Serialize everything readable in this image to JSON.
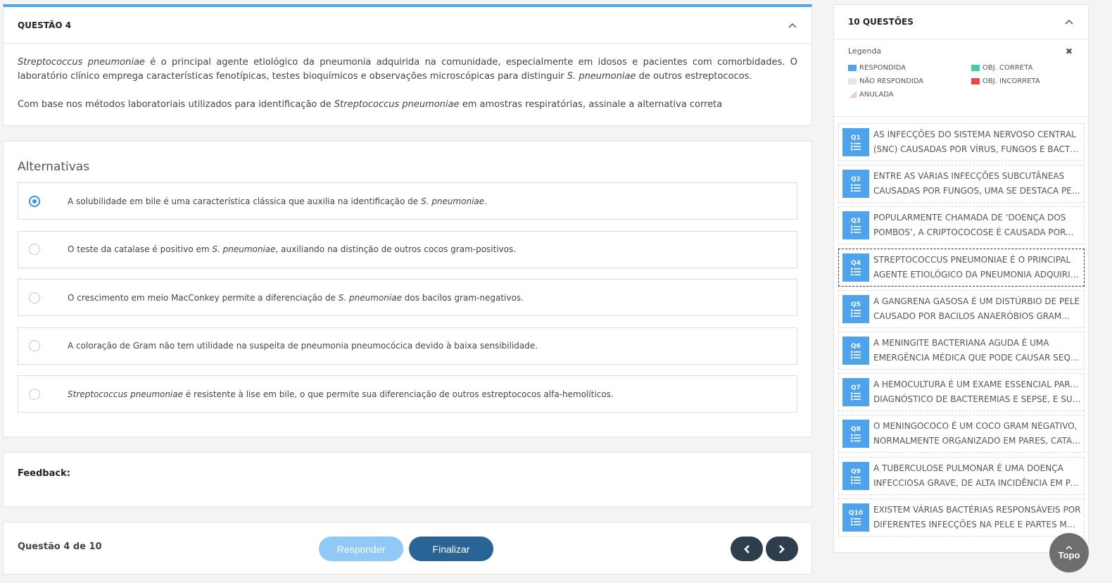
{
  "question": {
    "title": "QUESTÃO 4",
    "para1": [
      {
        "t": "Streptococcus pneumoniae",
        "i": true
      },
      {
        "t": " é o principal agente etiológico da pneumonia adquirida na comunidade, especialmente em idosos e pacientes com comorbidades. O laboratório clínico emprega características fenotípicas, testes bioquímicos e observações microscópicas para distinguir ",
        "i": false
      },
      {
        "t": "S. pneumoniae",
        "i": true
      },
      {
        "t": " de outros estreptococos.",
        "i": false
      }
    ],
    "para2": [
      {
        "t": "Com base nos métodos laboratoriais utilizados para identificação de ",
        "i": false
      },
      {
        "t": "Streptococcus pneumoniae",
        "i": true
      },
      {
        "t": " em amostras respiratórias, assinale a alternativa correta",
        "i": false
      }
    ]
  },
  "alternatives": {
    "title": "Alternativas",
    "items": [
      {
        "selected": true,
        "parts": [
          {
            "t": "A solubilidade em bile é uma característica clássica que auxilia na identificação de ",
            "i": false
          },
          {
            "t": "S. pneumoniae",
            "i": true
          },
          {
            "t": ".",
            "i": false
          }
        ]
      },
      {
        "selected": false,
        "parts": [
          {
            "t": "O teste da catalase é positivo em ",
            "i": false
          },
          {
            "t": "S. pneumoniae",
            "i": true
          },
          {
            "t": ", auxiliando na distinção de outros cocos gram-positivos.",
            "i": false
          }
        ]
      },
      {
        "selected": false,
        "parts": [
          {
            "t": "O crescimento em meio MacConkey permite a diferenciação de ",
            "i": false
          },
          {
            "t": "S. pneumoniae",
            "i": true
          },
          {
            "t": " dos bacilos gram-negativos.",
            "i": false
          }
        ]
      },
      {
        "selected": false,
        "parts": [
          {
            "t": "A coloração de Gram não tem utilidade na suspeita de pneumonia pneumocócica devido à baixa sensibilidade.",
            "i": false
          }
        ]
      },
      {
        "selected": false,
        "parts": [
          {
            "t": "Streptococcus pneumoniae",
            "i": true
          },
          {
            "t": " é resistente à lise em bile, o que permite sua diferenciação de outros estreptococos alfa-hemolíticos.",
            "i": false
          }
        ]
      }
    ]
  },
  "feedback": {
    "label": "Feedback:"
  },
  "nav": {
    "counter": "Questão 4 de 10",
    "responder": "Responder",
    "finalizar": "Finalizar"
  },
  "side": {
    "title": "10 QUESTÕES",
    "legend": {
      "title": "Legenda",
      "close": "✖",
      "items": [
        {
          "label": "RESPONDIDA",
          "color": "#4da3ec"
        },
        {
          "label": "OBJ. CORRETA",
          "color": "#3ecfa8"
        },
        {
          "label": "NÃO RESPONDIDA",
          "color": "#e6e6e6"
        },
        {
          "label": "OBJ. INCORRETA",
          "color": "#e8474c"
        },
        {
          "label": "ANULADA",
          "color": "#f7c7c7"
        }
      ]
    },
    "questions": [
      {
        "num": "Q1",
        "l1": "AS INFECÇÕES DO SISTEMA NERVOSO CENTRAL",
        "l2": "(SNC) CAUSADAS POR VÍRUS, FUNGOS E BACTÉRIAS..."
      },
      {
        "num": "Q2",
        "l1": "ENTRE AS VÁRIAS INFECÇÕES SUBCUTÂNEAS",
        "l2": "CAUSADAS POR FUNGOS, UMA SE DESTACA PELA..."
      },
      {
        "num": "Q3",
        "l1": "POPULARMENTE CHAMADA DE ‘DOENÇA DOS",
        "l2": "POMBOS’, A CRIPTOCOCOSE É CAUSADA POR..."
      },
      {
        "num": "Q4",
        "l1": "STREPTOCOCCUS PNEUMONIAE É O PRINCIPAL",
        "l2": "AGENTE ETIOLÓGICO DA PNEUMONIA ADQUIRIDA..."
      },
      {
        "num": "Q5",
        "l1": "A GANGRENA GASOSA É UM DISTÚRBIO DE PELE",
        "l2": "CAUSADO POR BACILOS ANAERÓBIOS GRAM..."
      },
      {
        "num": "Q6",
        "l1": "A MENINGITE BACTERIANA AGUDA É UMA",
        "l2": "EMERGÊNCIA MÉDICA QUE PODE CAUSAR SEQUELAS..."
      },
      {
        "num": "Q7",
        "l1": "A HEMOCULTURA É UM EXAME ESSENCIAL PARA O",
        "l2": "DIAGNÓSTICO DE BACTEREMIAS E SEPSE, E SUA..."
      },
      {
        "num": "Q8",
        "l1": "O MENINGOCOCO É UM COCO GRAM NEGATIVO,",
        "l2": "NORMALMENTE ORGANIZADO EM PARES, CATALASE..."
      },
      {
        "num": "Q9",
        "l1": "A TUBERCULOSE PULMONAR É UMA DOENÇA",
        "l2": "INFECCIOSA GRAVE, DE ALTA INCIDÊNCIA EM PAÍSES..."
      },
      {
        "num": "Q10",
        "l1": "EXISTEM VÁRIAS BACTÉRIAS RESPONSÁVEIS POR",
        "l2": "DIFERENTES INFECÇÕES NA PELE E PARTES MOLES,..."
      }
    ],
    "current": 3
  },
  "topo": {
    "label": "Topo"
  },
  "icons": {
    "collapse": "chevron-up-icon",
    "list": "list-icon",
    "prev": "chevron-left-icon",
    "next": "chevron-right-icon"
  }
}
